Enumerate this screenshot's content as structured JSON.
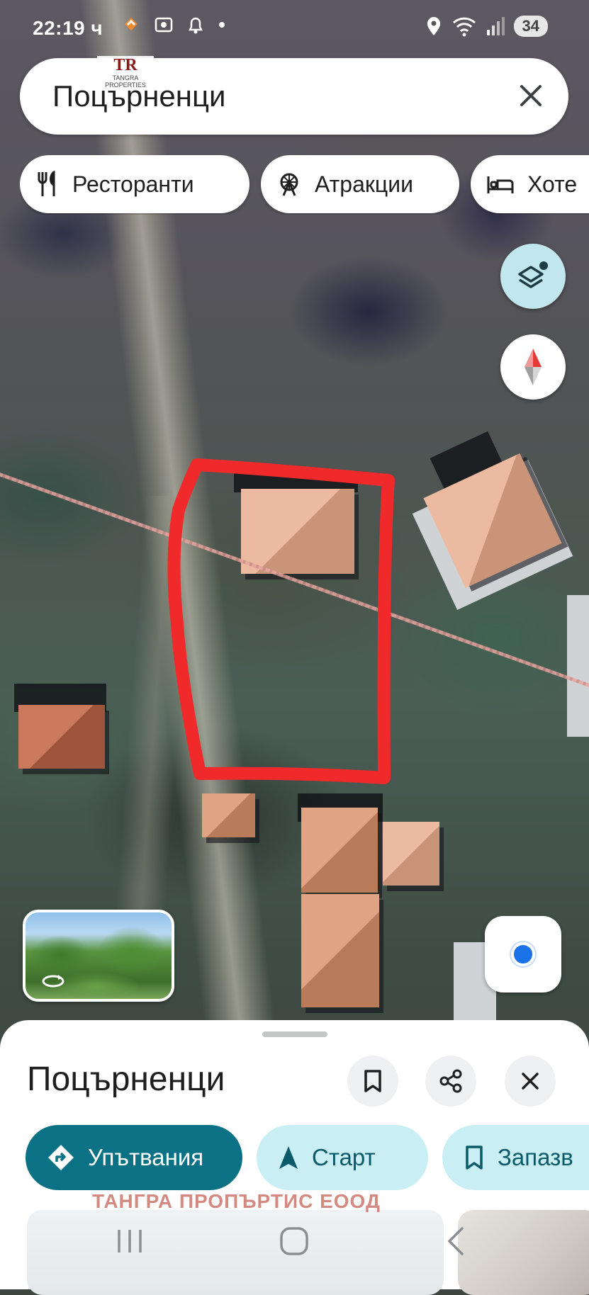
{
  "status_bar": {
    "time": "22:19 ч",
    "battery": "34",
    "icons_left": [
      "shield-app-icon",
      "screenshot-icon",
      "bell-icon",
      "dot-icon"
    ],
    "icons_right": [
      "location-icon",
      "wifi-icon",
      "signal-icon"
    ]
  },
  "search": {
    "query": "Поцърненци",
    "clear_icon": "close-icon"
  },
  "logo": {
    "mark": "TR",
    "text_line1": "TANGRA",
    "text_line2": "PROPERTIES"
  },
  "chips": [
    {
      "label": "Ресторанти",
      "icon": "fork-knife-icon"
    },
    {
      "label": "Атракции",
      "icon": "ferris-wheel-icon"
    },
    {
      "label": "Хоте",
      "icon": "bed-icon"
    }
  ],
  "map_buttons": {
    "layers_icon": "layers-icon",
    "compass_icon": "compass-icon",
    "location_icon": "my-location-icon"
  },
  "sheet": {
    "title": "Поцърненци",
    "buttons": [
      "bookmark-icon",
      "share-icon",
      "close-icon"
    ],
    "actions": [
      {
        "label": "Упътвания",
        "icon": "directions-icon",
        "style": "primary"
      },
      {
        "label": "Старт",
        "icon": "navigation-arrow-icon",
        "style": "secondary"
      },
      {
        "label": "Запазв",
        "icon": "bookmark-icon",
        "style": "secondary"
      }
    ],
    "watermark": "ТАНГРА ПРОПЪРТИС  ЕООД"
  },
  "colors": {
    "primary_action": "#0b7285",
    "secondary_action": "#c9eff5",
    "marker_red": "#f02a2a",
    "location_blue": "#1a73e8"
  }
}
